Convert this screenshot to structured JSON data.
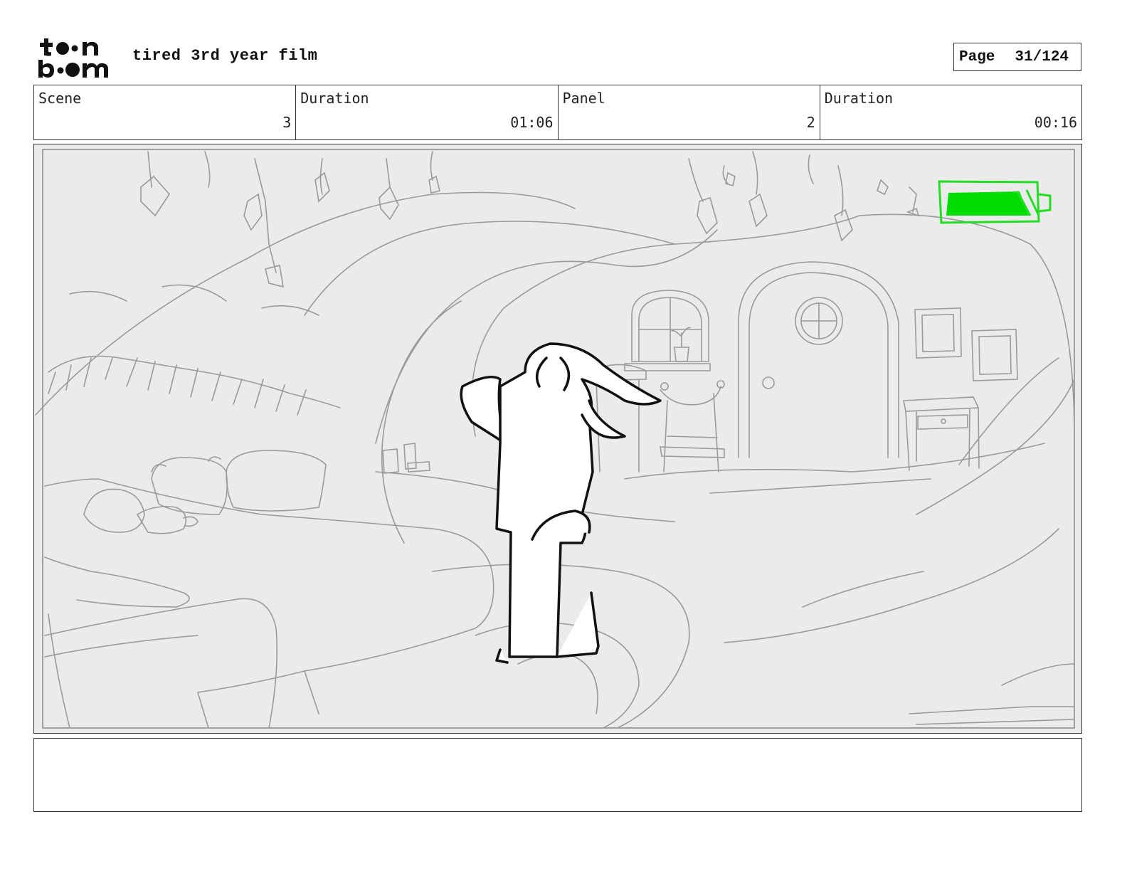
{
  "header": {
    "logo_text": "toon boom",
    "title": "tired 3rd year film",
    "page_label": "Page",
    "page_number": "31/124"
  },
  "info": {
    "scene_label": "Scene",
    "scene_value": "3",
    "scene_duration_label": "Duration",
    "scene_duration_value": "01:06",
    "panel_label": "Panel",
    "panel_value": "2",
    "panel_duration_label": "Duration",
    "panel_duration_value": "00:16"
  },
  "panel_image": {
    "description_icon": "storyboard-sketch",
    "battery_color": "#00e000"
  },
  "notes": {
    "text": ""
  }
}
